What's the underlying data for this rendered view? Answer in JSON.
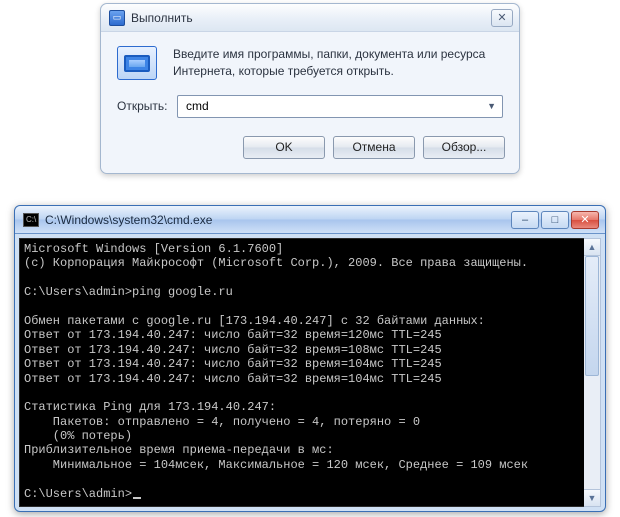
{
  "run": {
    "title": "Выполнить",
    "description": "Введите имя программы, папки, документа или ресурса Интернета, которые требуется открыть.",
    "open_label": "Открыть:",
    "input_value": "cmd",
    "buttons": {
      "ok": "OK",
      "cancel": "Отмена",
      "browse": "Обзор..."
    },
    "icon_name": "run-icon",
    "close_glyph": "✕"
  },
  "console": {
    "title": "C:\\Windows\\system32\\cmd.exe",
    "controls": {
      "min": "–",
      "max": "□",
      "close": "✕"
    },
    "lines": [
      "Microsoft Windows [Version 6.1.7600]",
      "(c) Корпорация Майкрософт (Microsoft Corp.), 2009. Все права защищены.",
      "",
      "C:\\Users\\admin>ping google.ru",
      "",
      "Обмен пакетами с google.ru [173.194.40.247] с 32 байтами данных:",
      "Ответ от 173.194.40.247: число байт=32 время=120мс TTL=245",
      "Ответ от 173.194.40.247: число байт=32 время=108мс TTL=245",
      "Ответ от 173.194.40.247: число байт=32 время=104мс TTL=245",
      "Ответ от 173.194.40.247: число байт=32 время=104мс TTL=245",
      "",
      "Статистика Ping для 173.194.40.247:",
      "    Пакетов: отправлено = 4, получено = 4, потеряно = 0",
      "    (0% потерь)",
      "Приблизительное время приема-передачи в мс:",
      "    Минимальное = 104мсек, Максимальное = 120 мсек, Среднее = 109 мсек",
      "",
      "C:\\Users\\admin>_"
    ]
  }
}
